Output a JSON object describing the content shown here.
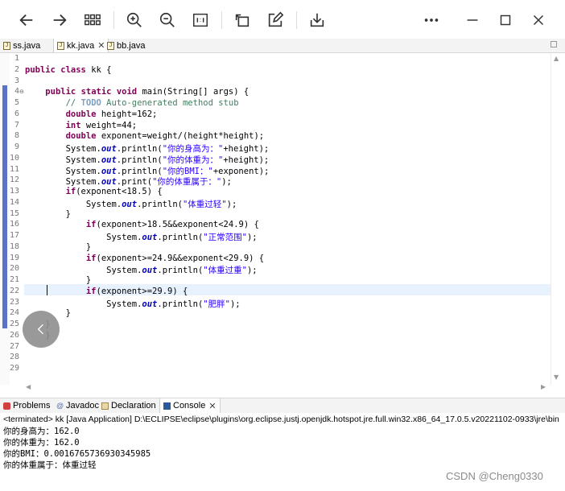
{
  "toolbar": {
    "icons": [
      "back-arrow-icon",
      "forward-arrow-icon",
      "grid-view-icon",
      "zoom-in-icon",
      "zoom-out-icon",
      "actual-size-icon",
      "rotate-icon",
      "edit-icon",
      "download-icon",
      "more-icon",
      "minimize-icon",
      "maximize-icon",
      "close-icon"
    ]
  },
  "editor_tabs": [
    {
      "label": "ss.java"
    },
    {
      "label": "kk.java",
      "close": "✕"
    },
    {
      "label": "bb.java"
    }
  ],
  "code_lines": [
    {
      "n": "1",
      "html": ""
    },
    {
      "n": "2",
      "html": "<span class=\"kw\">public</span> <span class=\"kw\">class</span> kk {"
    },
    {
      "n": "3",
      "html": ""
    },
    {
      "n": "4",
      "html": "    <span class=\"kw\">public</span> <span class=\"kw\">static</span> <span class=\"kw\">void</span> main(String[] args) {",
      "fold": "⊖"
    },
    {
      "n": "5",
      "html": "        <span class=\"cm\">// </span><span class=\"todo\">TODO</span><span class=\"cm\"> Auto-generated method stub</span>"
    },
    {
      "n": "6",
      "html": "        <span class=\"kw\">double</span> height=162;"
    },
    {
      "n": "7",
      "html": "        <span class=\"kw\">int</span> weight=44;"
    },
    {
      "n": "8",
      "html": "        <span class=\"kw\">double</span> exponent=weight/(height*height);"
    },
    {
      "n": "9",
      "html": "        System.<span class=\"fld\">out</span>.println(<span class=\"str\">\"你的身高为：\"</span>+height);"
    },
    {
      "n": "10",
      "html": "        System.<span class=\"fld\">out</span>.println(<span class=\"str\">\"你的体重为：\"</span>+height);"
    },
    {
      "n": "11",
      "html": "        System.<span class=\"fld\">out</span>.println(<span class=\"str\">\"你的BMI：\"</span>+exponent);"
    },
    {
      "n": "12",
      "html": "        System.<span class=\"fld\">out</span>.print(<span class=\"str\">\"你的体重属于：\"</span>);"
    },
    {
      "n": "13",
      "html": "        <span class=\"kw\">if</span>(exponent<18.5) {"
    },
    {
      "n": "14",
      "html": "            System.<span class=\"fld\">out</span>.println(<span class=\"str\">\"体重过轻\"</span>);"
    },
    {
      "n": "15",
      "html": "        }"
    },
    {
      "n": "16",
      "html": "            <span class=\"kw\">if</span>(exponent>18.5&&exponent<24.9) {"
    },
    {
      "n": "17",
      "html": "                System.<span class=\"fld\">out</span>.println(<span class=\"str\">\"正常范围\"</span>);"
    },
    {
      "n": "18",
      "html": "            }"
    },
    {
      "n": "19",
      "html": "            <span class=\"kw\">if</span>(exponent>=24.9&&exponent<29.9) {"
    },
    {
      "n": "20",
      "html": "                System.<span class=\"fld\">out</span>.println(<span class=\"str\">\"体重过重\"</span>);"
    },
    {
      "n": "21",
      "html": "            }"
    },
    {
      "n": "22",
      "html": "            <span class=\"kw\">if</span>(exponent>=29.9) {"
    },
    {
      "n": "23",
      "html": "                System.<span class=\"fld\">out</span>.println(<span class=\"str\">\"肥胖\"</span>);"
    },
    {
      "n": "24",
      "html": "        }"
    },
    {
      "n": "25",
      "html": "    }"
    },
    {
      "n": "26",
      "html": "    }"
    },
    {
      "n": "27",
      "html": ""
    },
    {
      "n": "28",
      "html": ""
    },
    {
      "n": "29",
      "html": ""
    }
  ],
  "view_tabs": [
    {
      "label": "Problems"
    },
    {
      "label": "Javadoc"
    },
    {
      "label": "Declaration"
    },
    {
      "label": "Console",
      "close": "✕"
    }
  ],
  "console": {
    "terminated": "<terminated> kk [Java Application] D:\\ECLIPSE\\eclipse\\plugins\\org.eclipse.justj.openjdk.hotspot.jre.full.win32.x86_64_17.0.5.v20221102-0933\\jre\\bin",
    "output": [
      "你的身高为：162.0",
      "你的体重为：162.0",
      "你的BMI：0.0016765736930345985",
      "你的体重属于：体重过轻"
    ]
  },
  "watermark": "CSDN @Cheng0330",
  "colors": {
    "keyword": "#7f0055",
    "string": "#2a00ff",
    "comment": "#3f7f5f",
    "field": "#0000c0"
  }
}
